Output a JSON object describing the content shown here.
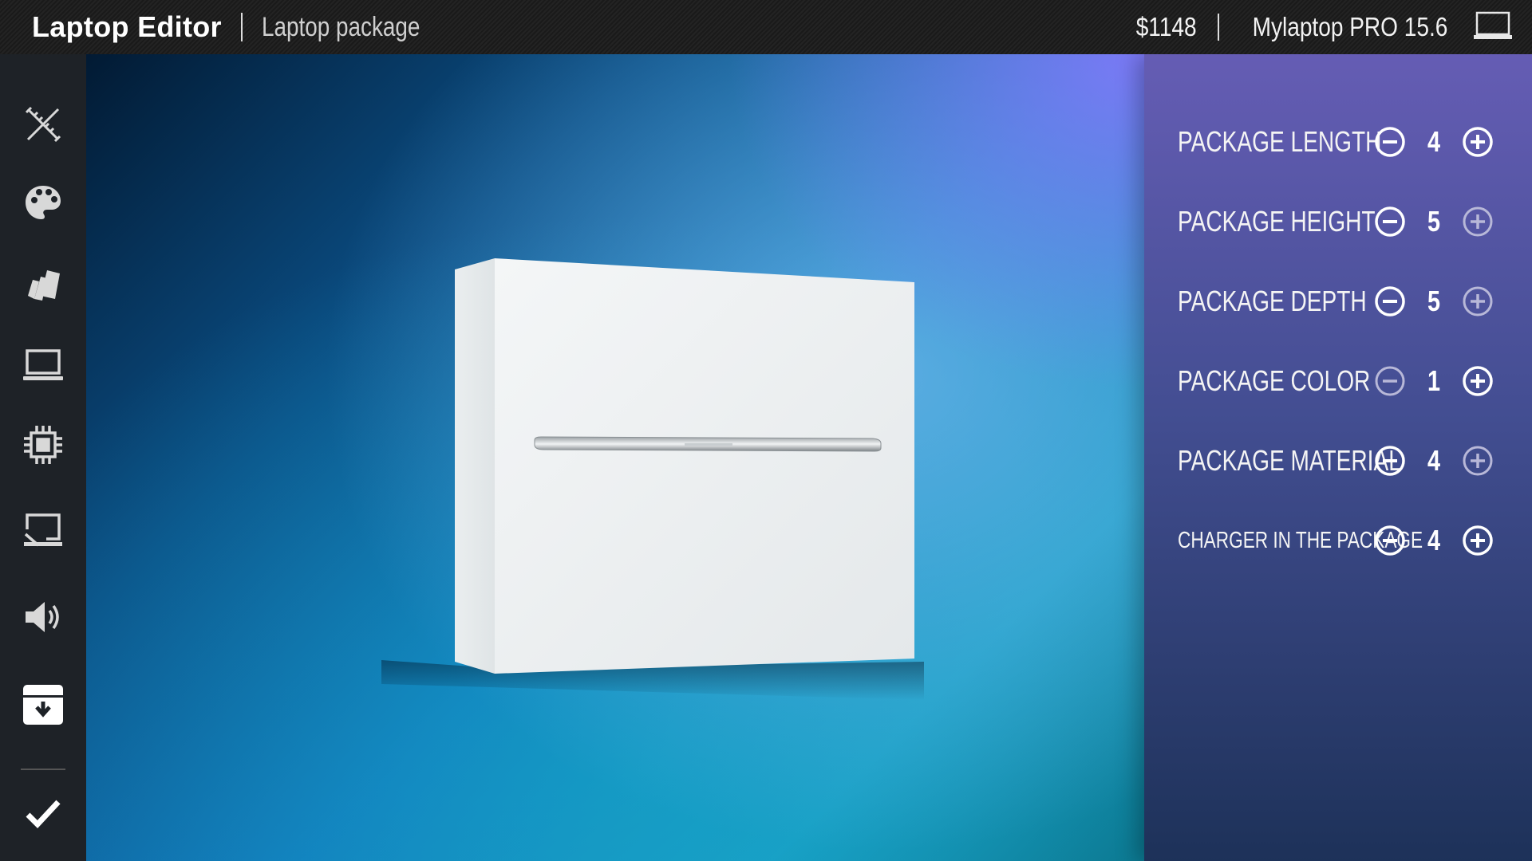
{
  "header": {
    "app_title": "Laptop Editor",
    "page_name": "Laptop package",
    "price": "$1148",
    "model": "Mylaptop PRO 15.6",
    "laptop_icon": "laptop-outline-icon"
  },
  "sidebar": {
    "items": [
      {
        "name": "tools",
        "icon": "ruler-pencil-icon"
      },
      {
        "name": "colors",
        "icon": "palette-icon"
      },
      {
        "name": "materials",
        "icon": "swatches-icon"
      },
      {
        "name": "laptop",
        "icon": "laptop-icon"
      },
      {
        "name": "processor",
        "icon": "chip-icon"
      },
      {
        "name": "display",
        "icon": "screen-cast-icon"
      },
      {
        "name": "sound",
        "icon": "speaker-icon"
      },
      {
        "name": "package",
        "icon": "archive-download-icon",
        "active": true
      }
    ],
    "confirm_icon": "checkmark-icon"
  },
  "options": [
    {
      "label": "PACKAGE LENGTH",
      "value": "4",
      "minus_enabled": true,
      "plus_enabled": true
    },
    {
      "label": "PACKAGE HEIGHT",
      "value": "5",
      "minus_enabled": true,
      "plus_enabled": false
    },
    {
      "label": "PACKAGE DEPTH",
      "value": "5",
      "minus_enabled": true,
      "plus_enabled": false
    },
    {
      "label": "PACKAGE COLOR",
      "value": "1",
      "minus_enabled": false,
      "plus_enabled": true
    },
    {
      "label": "PACKAGE MATERIAL",
      "value": "4",
      "minus_enabled": true,
      "plus_enabled": false
    },
    {
      "label": "CHARGER IN THE PACKAGE",
      "value": "4",
      "minus_enabled": true,
      "plus_enabled": true
    }
  ],
  "colors": {
    "enabled": "#ffffff",
    "disabled": "#b8b8d8",
    "sidebar_bg": "#1e2227"
  }
}
